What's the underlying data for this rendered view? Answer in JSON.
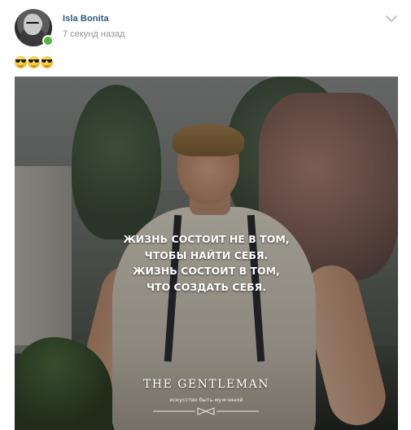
{
  "post": {
    "author": "Isla Bonita",
    "time": "7 секунд назад",
    "emojis": [
      "sunglasses-emoji",
      "sunglasses-emoji",
      "sunglasses-emoji"
    ],
    "online": true
  },
  "image": {
    "quote_lines": [
      "ЖИЗНЬ СОСТОИТ НЕ В ТОМ,",
      "ЧТОБЫ НАЙТИ СЕБЯ.",
      "ЖИЗНЬ СОСТОИТ В ТОМ,",
      "ЧТО СОЗДАТЬ СЕБЯ."
    ],
    "brand": "The Gentleman",
    "tagline": "искусство быть мужчиной"
  },
  "colors": {
    "author_link": "#2a5885",
    "timestamp": "#939393",
    "online_indicator": "#55b73c"
  }
}
